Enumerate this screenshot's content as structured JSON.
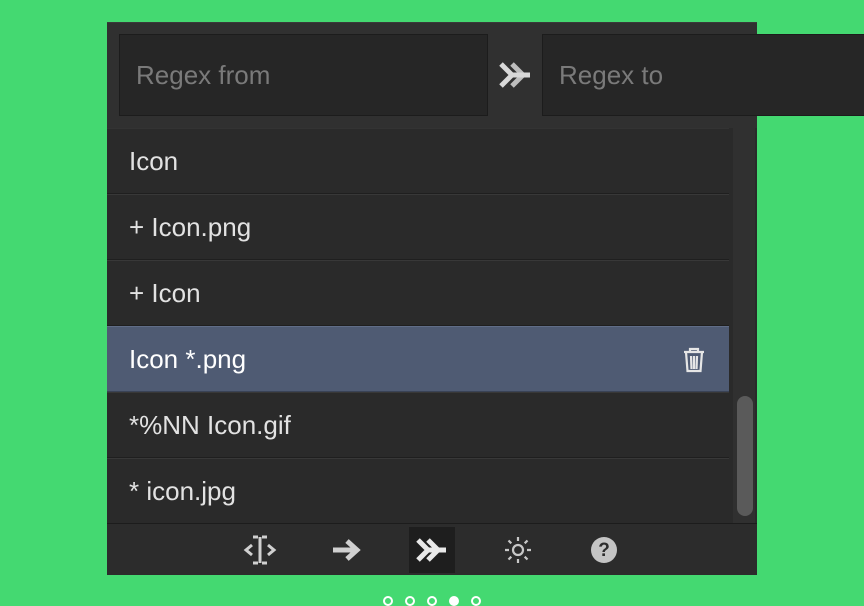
{
  "inputs": {
    "from_placeholder": "Regex from",
    "from_value": "",
    "to_placeholder": "Regex to",
    "to_value": ""
  },
  "list": {
    "items": [
      {
        "label": "Icon",
        "selected": false,
        "has_delete": false
      },
      {
        "label": "+ Icon.png",
        "selected": false,
        "has_delete": false
      },
      {
        "label": "+ Icon",
        "selected": false,
        "has_delete": false
      },
      {
        "label": "Icon *.png",
        "selected": true,
        "has_delete": true
      },
      {
        "label": "*%NN Icon.gif",
        "selected": false,
        "has_delete": false
      },
      {
        "label": "* icon.jpg",
        "selected": false,
        "has_delete": false
      }
    ]
  },
  "toolbar": {
    "buttons": [
      {
        "name": "text-cursor-icon",
        "active": false
      },
      {
        "name": "arrow-right-icon",
        "active": false
      },
      {
        "name": "double-arrow-right-icon",
        "active": true
      },
      {
        "name": "gear-icon",
        "active": false
      },
      {
        "name": "help-icon",
        "active": false
      }
    ]
  },
  "page_dots": {
    "count": 5,
    "active_index": 3
  }
}
